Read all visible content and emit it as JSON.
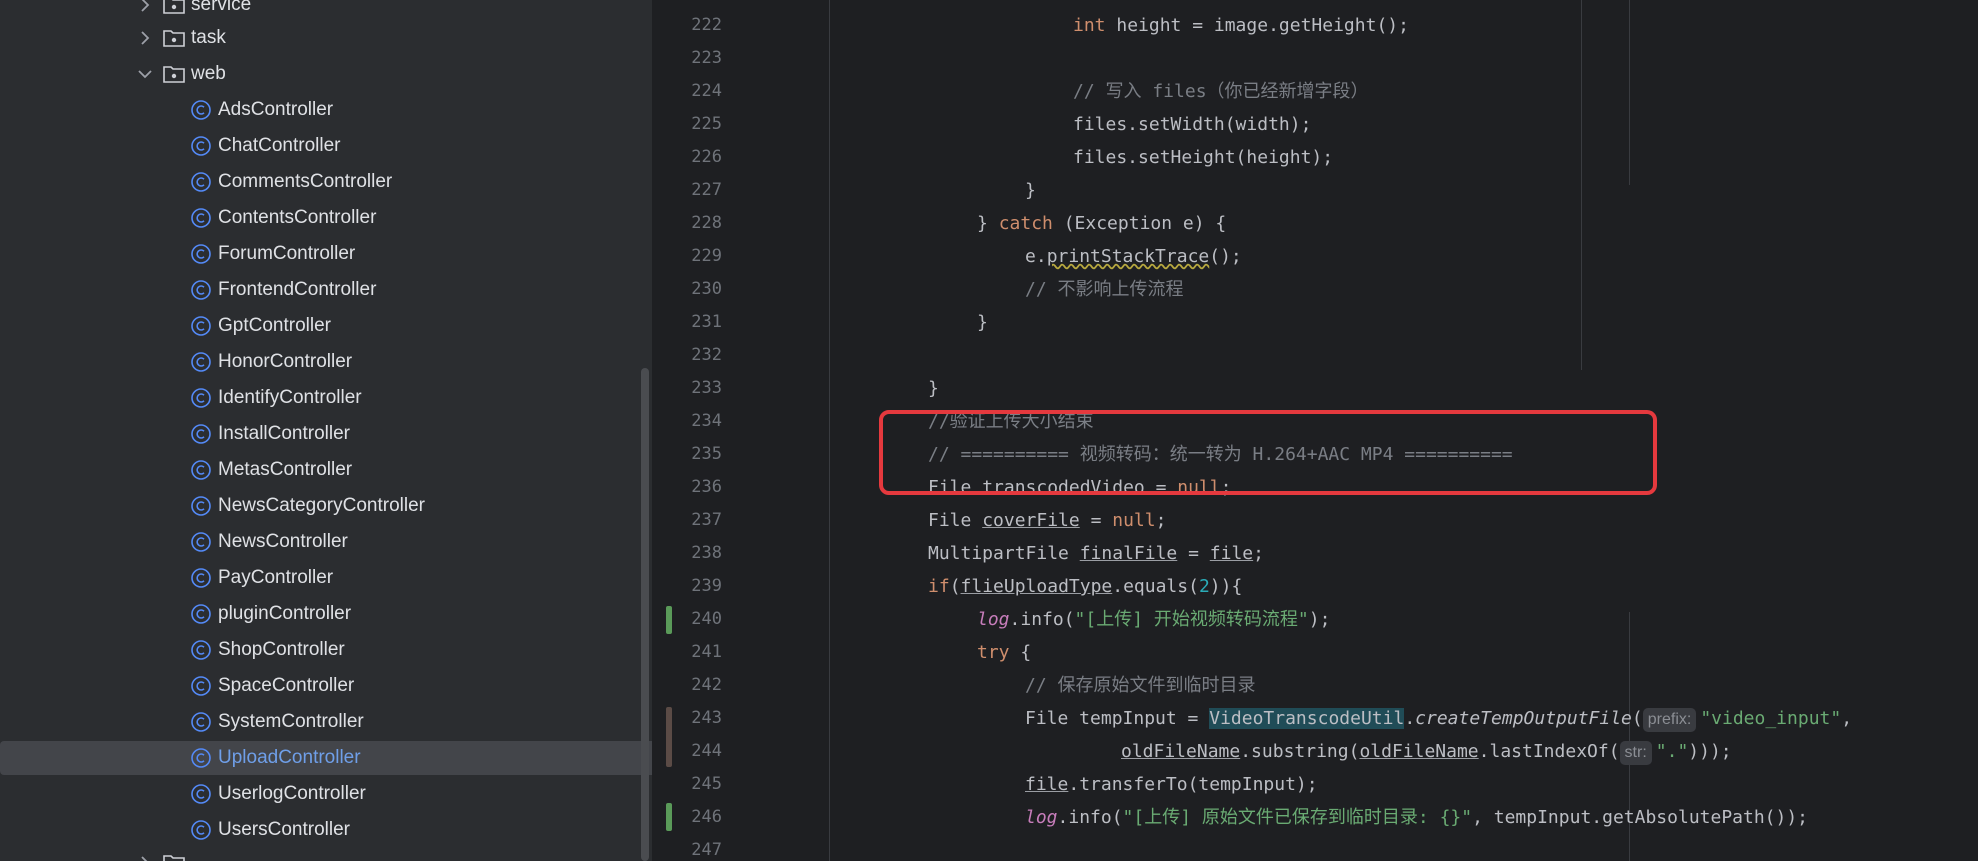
{
  "tree": {
    "folders": [
      "service",
      "task",
      "web"
    ],
    "items": [
      "AdsController",
      "ChatController",
      "CommentsController",
      "ContentsController",
      "ForumController",
      "FrontendController",
      "GptController",
      "HonorController",
      "IdentifyController",
      "InstallController",
      "MetasController",
      "NewsCategoryController",
      "NewsController",
      "PayController",
      "pluginController",
      "ShopController",
      "SpaceController",
      "SystemController",
      "UploadController",
      "UserlogController",
      "UsersController"
    ],
    "selected": "UploadController"
  },
  "editor": {
    "line_numbers": [
      "222",
      "223",
      "224",
      "225",
      "226",
      "227",
      "228",
      "229",
      "230",
      "231",
      "232",
      "233",
      "234",
      "235",
      "236",
      "237",
      "238",
      "239",
      "240",
      "241",
      "242",
      "243",
      "244",
      "245",
      "246",
      "247"
    ],
    "code": {
      "l222_int": "int",
      "l222_rest": " height = image.getHeight();",
      "l224": "// 写入 files（你已经新增字段）",
      "l225": "files.setWidth(width);",
      "l226": "files.setHeight(height);",
      "l227": "}",
      "l228_a": "} ",
      "l228_catch": "catch",
      "l228_b": " (Exception e) {",
      "l229_a": "e.",
      "l229_m": "printStackTrace",
      "l229_b": "();",
      "l230": "// 不影响上传流程",
      "l231": "}",
      "l233": "}",
      "l234": "//验证上传大小结束",
      "l235": "// ========== 视频转码：统一转为 H.264+AAC MP4 ==========",
      "l236_a": "File ",
      "l236_var": "transcodedVideo",
      "l236_b": " = ",
      "l236_null": "null",
      "l236_c": ";",
      "l237_a": "File ",
      "l237_var": "coverFile",
      "l237_b": " = ",
      "l237_null": "null",
      "l237_c": ";",
      "l238_a": "MultipartFile ",
      "l238_var": "finalFile",
      "l238_b": " = ",
      "l238_file": "file",
      "l238_c": ";",
      "l239_if": "if",
      "l239_a": "(",
      "l239_var": "flieUploadType",
      "l239_b": ".equals(",
      "l239_num": "2",
      "l239_c": ")){",
      "l240_log": "log",
      "l240_a": ".info(",
      "l240_str": "\"[上传] 开始视频转码流程\"",
      "l240_b": ");",
      "l241_try": "try",
      "l241_a": " {",
      "l242": "// 保存原始文件到临时目录",
      "l243_a": "File tempInput = ",
      "l243_cls": "VideoTranscodeUtil",
      "l243_b": ".",
      "l243_m": "createTempOutputFile",
      "l243_c": "(",
      "l243_hint": "prefix:",
      "l243_str": "\"video_input\"",
      "l243_d": ",",
      "l244_var1": "oldFileName",
      "l244_a": ".substring(",
      "l244_var2": "oldFileName",
      "l244_b": ".lastIndexOf(",
      "l244_hint": "str:",
      "l244_str": "\".\"",
      "l244_c": ")));",
      "l245_file": "file",
      "l245_a": ".transferTo(tempInput);",
      "l246_log": "log",
      "l246_a": ".info(",
      "l246_str": "\"[上传] 原始文件已保存到临时目录: {}\"",
      "l246_b": ", tempInput.getAbsolutePath());"
    }
  },
  "colors": {
    "annotation_box": "#e5393e",
    "added_marker": "#5a9a59",
    "modified_marker": "#5b4b46",
    "selection_text": "#6f9fe9"
  }
}
